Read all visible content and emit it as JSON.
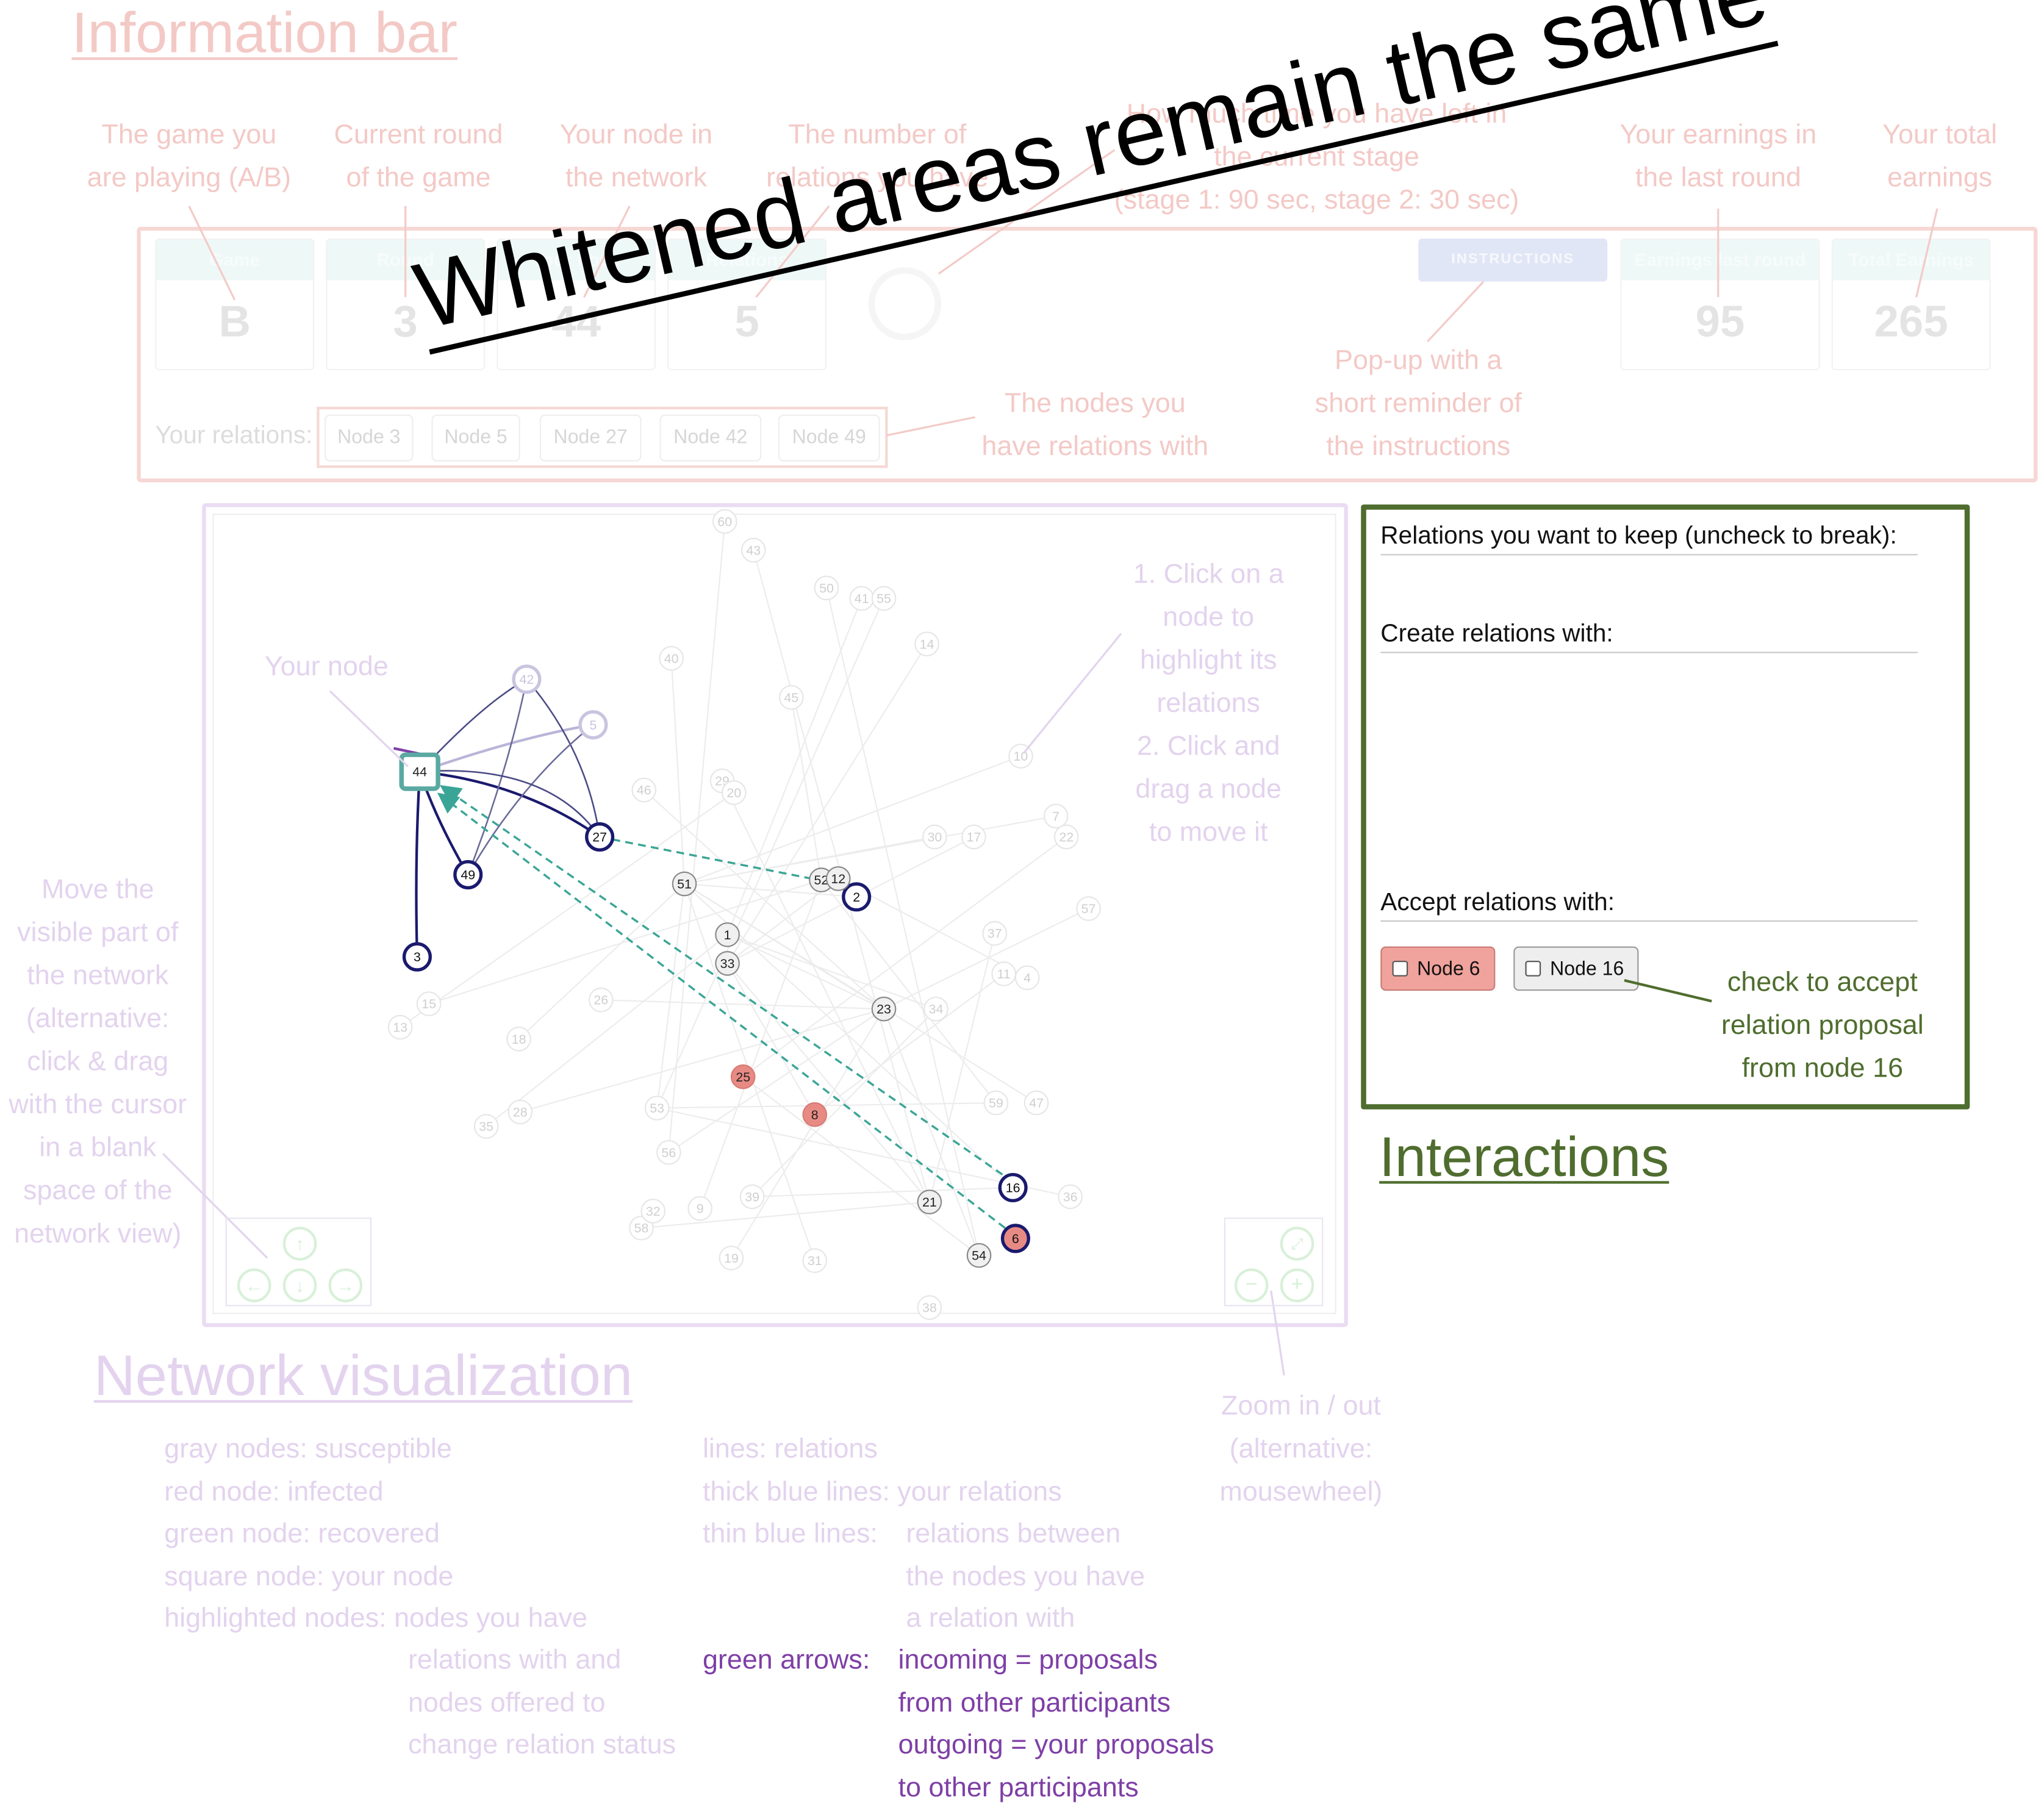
{
  "titles": {
    "information_bar": "Information bar",
    "network_visualization": "Network visualization",
    "interactions": "Interactions",
    "overlay": "Whitened areas remain the same"
  },
  "info_annotations": {
    "game": [
      "The game you",
      "are playing (A/B)"
    ],
    "round": [
      "Current round",
      "of the game"
    ],
    "your_node": [
      "Your node in",
      "the network"
    ],
    "relations": [
      "The number of",
      "relations you have"
    ],
    "time": [
      "How much time you have left in",
      "the current stage",
      "(stage 1: 90 sec, stage 2: 30 sec)"
    ],
    "earnings_last": [
      "Your earnings in",
      "the last round"
    ],
    "total_earnings": [
      "Your total",
      "earnings"
    ],
    "popup": [
      "Pop-up with a",
      "short reminder of",
      "the instructions"
    ],
    "nodes_with": [
      "The nodes you",
      "have relations with"
    ]
  },
  "info_bar": {
    "game": {
      "label": "Game",
      "value": "B"
    },
    "round": {
      "label": "Round",
      "value": "3"
    },
    "your_node": {
      "label": "Your node",
      "value": "44"
    },
    "relations": {
      "label": "Relations",
      "value": "5"
    },
    "instructions_button": "INSTRUCTIONS",
    "earnings_last_round": {
      "label": "Earnings last round",
      "value": "95"
    },
    "total_earnings": {
      "label": "Total Earnings",
      "value": "265"
    },
    "your_relations_label": "Your relations:",
    "relation_chips": [
      "Node 3",
      "Node 5",
      "Node 27",
      "Node 42",
      "Node 49"
    ]
  },
  "network": {
    "your_node_label": "Your node",
    "instructions": [
      "1. Click on a",
      "node to",
      "highlight its",
      "relations",
      "2. Click and",
      "drag a node",
      "to move it"
    ],
    "move_hint": [
      "Move the",
      "visible part of",
      "the network",
      "(alternative:",
      "click & drag",
      "with the cursor",
      "in a blank",
      "space of the",
      "network view)"
    ],
    "zoom_hint": [
      "Zoom in / out",
      "(alternative:",
      "mousewheel)"
    ],
    "nav_icons": [
      "pan-up-icon",
      "pan-left-icon",
      "pan-down-icon",
      "pan-right-icon"
    ],
    "zoom_icons": [
      "zoom-fit-icon",
      "zoom-out-icon",
      "zoom-in-icon"
    ],
    "colors": {
      "susceptible": "#f0f0f0",
      "infected": "#e88a84",
      "highlight_ring": "#1a1a6e",
      "arrow": "#3aa596",
      "own_node": "#5aa9a2"
    },
    "nodes": [
      {
        "id": "44",
        "own": true
      },
      {
        "id": "3",
        "ring": true
      },
      {
        "id": "5",
        "ring": true
      },
      {
        "id": "27",
        "ring": true
      },
      {
        "id": "42",
        "ring": true
      },
      {
        "id": "49",
        "ring": true
      },
      {
        "id": "2",
        "ring": true
      },
      {
        "id": "16",
        "ring": true
      },
      {
        "id": "6",
        "ring": true,
        "infected": true
      },
      {
        "id": "25",
        "infected": true
      },
      {
        "id": "8",
        "infected": true
      },
      {
        "id": "51"
      },
      {
        "id": "52"
      },
      {
        "id": "1"
      },
      {
        "id": "33"
      },
      {
        "id": "23"
      },
      {
        "id": "21"
      },
      {
        "id": "54"
      },
      {
        "id": "12"
      },
      {
        "id": "60"
      },
      {
        "id": "43"
      },
      {
        "id": "50"
      },
      {
        "id": "41"
      },
      {
        "id": "55"
      },
      {
        "id": "14"
      },
      {
        "id": "40"
      },
      {
        "id": "45"
      },
      {
        "id": "10"
      },
      {
        "id": "46"
      },
      {
        "id": "29"
      },
      {
        "id": "20"
      },
      {
        "id": "30"
      },
      {
        "id": "17"
      },
      {
        "id": "7"
      },
      {
        "id": "22"
      },
      {
        "id": "57"
      },
      {
        "id": "37"
      },
      {
        "id": "11"
      },
      {
        "id": "4"
      },
      {
        "id": "34"
      },
      {
        "id": "26"
      },
      {
        "id": "15"
      },
      {
        "id": "13"
      },
      {
        "id": "18"
      },
      {
        "id": "28"
      },
      {
        "id": "35"
      },
      {
        "id": "53"
      },
      {
        "id": "56"
      },
      {
        "id": "39"
      },
      {
        "id": "9"
      },
      {
        "id": "58"
      },
      {
        "id": "59"
      },
      {
        "id": "47"
      },
      {
        "id": "36"
      },
      {
        "id": "19"
      },
      {
        "id": "31"
      },
      {
        "id": "38"
      },
      {
        "id": "32"
      }
    ]
  },
  "interactions": {
    "keep_label": "Relations you want to keep (uncheck to break):",
    "create_label": "Create relations with:",
    "accept_label": "Accept relations with:",
    "accept_nodes": [
      "Node 6",
      "Node 16"
    ],
    "check_hint": [
      "check to accept",
      "relation proposal",
      "from node 16"
    ]
  },
  "legend": {
    "col1": [
      "gray nodes: susceptible",
      "red node: infected",
      "green node: recovered",
      "square node: your node",
      "highlighted nodes: nodes you have"
    ],
    "col1_cont": [
      "relations with and",
      "nodes offered to",
      "change relation status"
    ],
    "col2_left": [
      "lines: relations",
      "thick blue lines: your relations",
      "thin blue lines:"
    ],
    "col2_right": [
      "relations between",
      "the nodes you have",
      "a relation with"
    ],
    "green_arrows_label": "green arrows:",
    "green_arrows_text": [
      "incoming = proposals",
      "from other participants",
      "outgoing = your proposals",
      "to other participants"
    ]
  }
}
